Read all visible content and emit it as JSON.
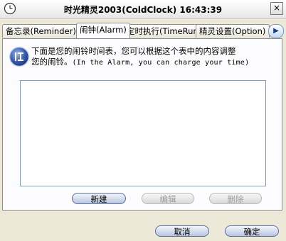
{
  "window": {
    "title": "时光精灵2003(ColdClock) 16:43:39",
    "close_glyph": "×"
  },
  "tabs": [
    {
      "label": "备忘录(Reminder)"
    },
    {
      "label": "闹钟(Alarm)"
    },
    {
      "label": "定时执行(TimeRun)"
    },
    {
      "label": "精灵设置(Option)"
    }
  ],
  "tab_scroll_glyph": "▶",
  "alarm": {
    "info_line1": "下面是您的闹铃时间表，您可以根据这个表中的内容调整",
    "info_line2_cn": "您的闹铃。",
    "info_line2_en": "(In the Alarm, you can charge your time)",
    "new_button": "新建",
    "edit_button": "编辑",
    "delete_button": "删除"
  },
  "footer": {
    "cancel_button": "取消",
    "ok_button": "确定"
  },
  "colors": {
    "accent": "#1d4fa0",
    "panel": "#fcfcfe",
    "window": "#ece9d8"
  }
}
